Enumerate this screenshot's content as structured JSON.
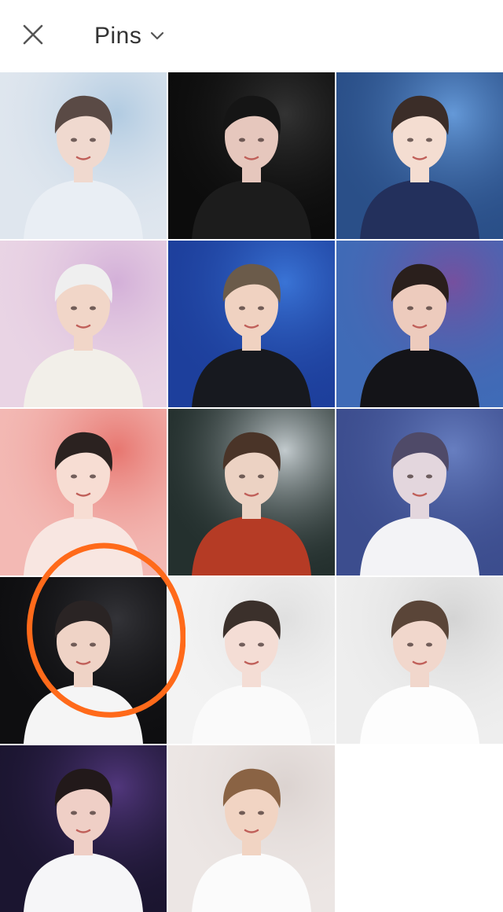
{
  "header": {
    "close_icon": "close-icon",
    "title": "Pins",
    "dropdown_icon": "chevron-down-icon"
  },
  "pins": [
    {
      "bg": "#dfe6ee",
      "accent": "#a9c6df",
      "skin": "#f0d9cf",
      "hair": "#5a4a45",
      "shirt": "#e9eef4"
    },
    {
      "bg": "#0c0c0c",
      "accent": "#3a3a3a",
      "skin": "#e6c7bd",
      "hair": "#151515",
      "shirt": "#1c1c1c"
    },
    {
      "bg": "#2a4f88",
      "accent": "#6fa6e6",
      "skin": "#f4ddd1",
      "hair": "#3b2d28",
      "shirt": "#23305c"
    },
    {
      "bg": "#e9d4e4",
      "accent": "#cfa9d6",
      "skin": "#f1d6c8",
      "hair": "#efefef",
      "shirt": "#f2efe9"
    },
    {
      "bg": "#1d3f9c",
      "accent": "#3f7de0",
      "skin": "#f0d2c1",
      "hair": "#6b5b4a",
      "shirt": "#17191f"
    },
    {
      "bg": "#3f6bb7",
      "accent": "#7f4b9a",
      "skin": "#edcbbd",
      "hair": "#2a1f1c",
      "shirt": "#141418"
    },
    {
      "bg": "#f3b9b4",
      "accent": "#e56a63",
      "skin": "#f7ddd3",
      "hair": "#2b2220",
      "shirt": "#f8e6e1"
    },
    {
      "bg": "#24302e",
      "accent": "#dfe6ea",
      "skin": "#ecd2c3",
      "hair": "#4a3428",
      "shirt": "#b53b25"
    },
    {
      "bg": "#3c4d8e",
      "accent": "#6f87c9",
      "skin": "#e3d6dd",
      "hair": "#4f4a68",
      "shirt": "#f3f3f6"
    },
    {
      "bg": "#0e0e10",
      "accent": "#3a3a3f",
      "skin": "#efd3c6",
      "hair": "#2a2424",
      "shirt": "#f5f5f5"
    },
    {
      "bg": "#f3f3f3",
      "accent": "#dcdcdc",
      "skin": "#f4ddd5",
      "hair": "#3b302b",
      "shirt": "#fafafa"
    },
    {
      "bg": "#eeeeee",
      "accent": "#cfcfcf",
      "skin": "#f1d7cc",
      "hair": "#5a4538",
      "shirt": "#fdfdfd"
    },
    {
      "bg": "#1b1530",
      "accent": "#5b3d8a",
      "skin": "#efcfc6",
      "hair": "#22191a",
      "shirt": "#f6f6f8"
    },
    {
      "bg": "#ece6e4",
      "accent": "#d8cfcc",
      "skin": "#f1d4c3",
      "hair": "#8a6344",
      "shirt": "#fbfbfb"
    }
  ],
  "annotation": {
    "color": "#ff6a1a"
  }
}
